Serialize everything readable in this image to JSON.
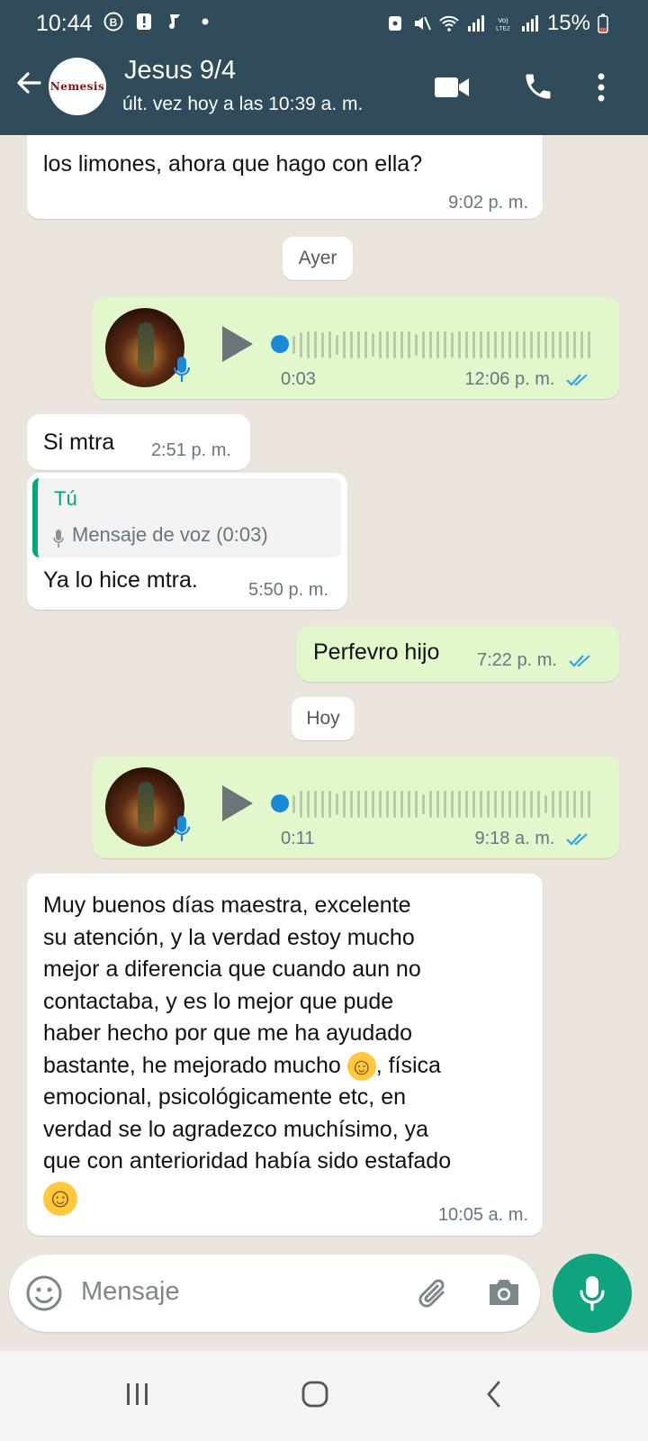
{
  "status_bar": {
    "time": "10:44",
    "battery": "15%"
  },
  "header": {
    "avatar_text": "Nemesis",
    "contact_name": "Jesus 9/4",
    "last_seen": "últ. vez hoy a las 10:39 a. m."
  },
  "messages": {
    "m1": {
      "text": "los limones, ahora que hago con ella?",
      "time": "9:02 p. m."
    },
    "date1": "Ayer",
    "voice1": {
      "duration": "0:03",
      "time": "12:06 p. m."
    },
    "m2": {
      "text": "Si mtra",
      "time": "2:51 p. m."
    },
    "m3": {
      "quote_author": "Tú",
      "quote_text": "Mensaje de voz (0:03)",
      "text": "Ya lo hice mtra.",
      "time": "5:50 p. m."
    },
    "m4": {
      "text": "Perfevro hijo",
      "time": "7:22 p. m."
    },
    "date2": "Hoy",
    "voice2": {
      "duration": "0:11",
      "time": "9:18 a. m."
    },
    "m5": {
      "lines": [
        "Muy buenos días maestra, excelente",
        "su atención, y la verdad estoy mucho",
        "mejor a diferencia que cuando aun no",
        "contactaba, y es lo mejor que pude",
        "haber hecho por que me ha ayudado",
        "bastante, he mejorado mucho",
        ", física",
        "emocional, psicológicamente etc, en",
        "verdad se lo agradezco muchísimo, ya",
        "que con anterioridad había sido estafado"
      ],
      "emoji": "☺",
      "time": "10:05 a. m."
    }
  },
  "input": {
    "placeholder": "Mensaje"
  },
  "colors": {
    "header_bg": "#304b5a",
    "outgoing_bubble": "#e2f8cc",
    "incoming_bubble": "#ffffff",
    "accent_green": "#10a37f",
    "read_ticks": "#34a4e6"
  },
  "icons": [
    "back-arrow-icon",
    "video-call-icon",
    "phone-icon",
    "more-options-icon",
    "play-icon",
    "mic-icon",
    "emoji-icon",
    "attach-icon",
    "camera-icon",
    "read-ticks-icon"
  ]
}
